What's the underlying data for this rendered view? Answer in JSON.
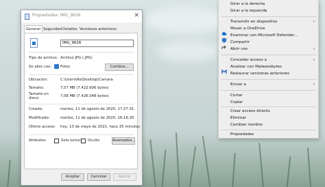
{
  "dialog": {
    "title": "Propiedades: IMG_9626",
    "close_glyph": "✕",
    "tabs": [
      "General",
      "Seguridad",
      "Detalles",
      "Versiones anteriores"
    ],
    "file_name": "IMG_9626",
    "file_type_label": "Tipo de archivo:",
    "file_type_value": "Archivo JPG (.JPG)",
    "opens_with_label": "Se abre con:",
    "opens_with_value": "Fotos",
    "change_button": "Cambiar...",
    "location_label": "Ubicación:",
    "location_value": "C:\\Users\\Ro\\Desktop\\Camara",
    "size_label": "Tamaño:",
    "size_value": "7,07 MB (7.422.606 bytes)",
    "size_disk_label": "Tamaño en disco:",
    "size_disk_value": "7,08 MB (7.426.048 bytes)",
    "created_label": "Creado:",
    "created_value": "martes, 11 de agosto de 2020, 17:27:31",
    "modified_label": "Modificado:",
    "modified_value": "martes, 11 de agosto de 2020, 16:18:26",
    "accessed_label": "Último acceso:",
    "accessed_value": "hoy, 13 de mayo de 2021, hace 25 minutos",
    "attributes_label": "Atributos:",
    "readonly_label": "Solo lectura",
    "hidden_label": "Oculto",
    "advanced_button": "Avanzados...",
    "ok_button": "Aceptar",
    "cancel_button": "Cancelar",
    "apply_button": "Aplicar"
  },
  "menu": {
    "rotate_right": "Girar a la derecha",
    "rotate_left": "Girar a la izquierda",
    "cast": "Transmitir en dispositivo",
    "onedrive": "Mover a OneDrive",
    "defender": "Examinar con Microsoft Defender...",
    "share": "Compartir",
    "open_with": "Abrir con",
    "grant_access": "Conceder acceso a",
    "malwarebytes": "Analizar con Malwarebytes",
    "restore_versions": "Restaurar versiones anteriores",
    "send_to": "Enviar a",
    "cut": "Cortar",
    "copy": "Copiar",
    "create_shortcut": "Crear acceso directo",
    "delete": "Eliminar",
    "rename": "Cambiar nombre",
    "properties": "Propiedades",
    "submenu_arrow": "›"
  },
  "colors": {
    "onedrive": "#1e73c8",
    "defender": "#2f78c8",
    "malwarebytes": "#1f5fae"
  }
}
